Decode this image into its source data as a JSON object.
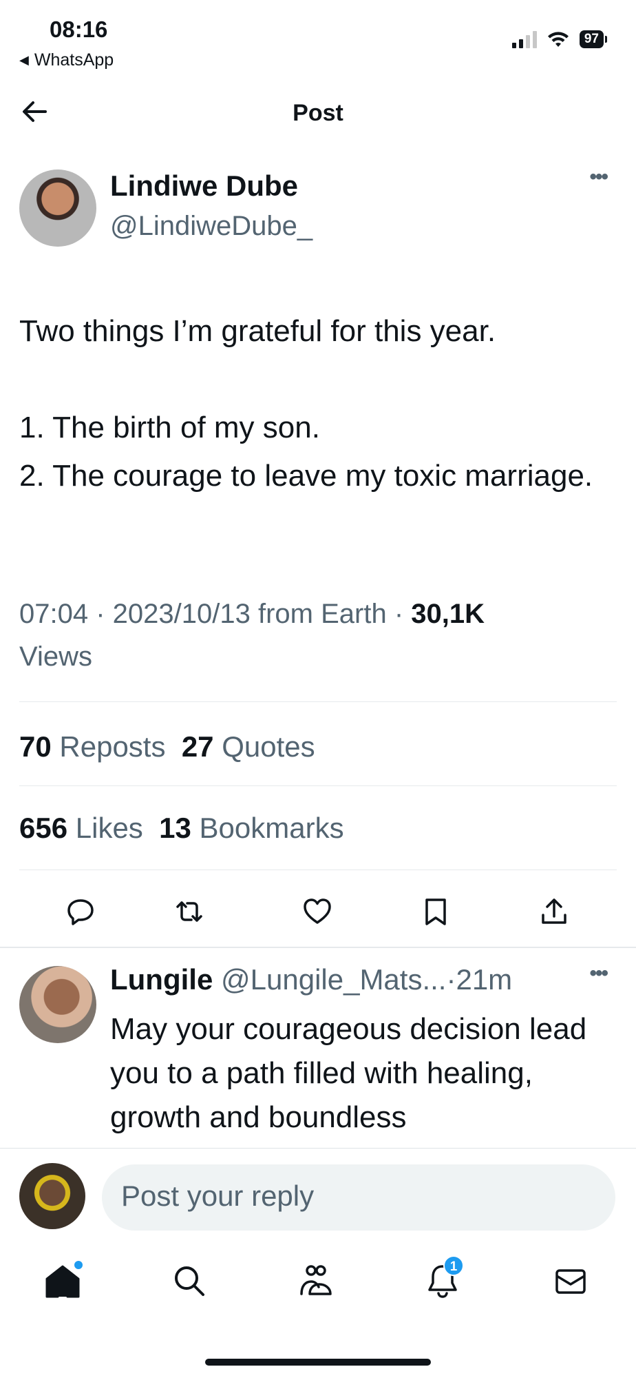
{
  "status_bar": {
    "time": "08:16",
    "back_app": "WhatsApp",
    "battery": "97"
  },
  "header": {
    "title": "Post"
  },
  "post": {
    "author_name": "Lindiwe Dube",
    "author_handle": "@LindiweDube_",
    "text": "Two things I’m grateful for this year.\n\n1. The birth of my son.\n2. The courage to leave my toxic marriage.",
    "time": "07:04",
    "date": "2023/10/13",
    "from_label": "from Earth",
    "views_count": "30,1K",
    "views_label": "Views",
    "reposts_count": "70",
    "reposts_label": "Reposts",
    "quotes_count": "27",
    "quotes_label": "Quotes",
    "likes_count": "656",
    "likes_label": "Likes",
    "bookmarks_count": "13",
    "bookmarks_label": "Bookmarks"
  },
  "reply": {
    "name": "Lungile",
    "handle": "@Lungile_Mats...",
    "age": "21m",
    "text": "May your courageous decision lead you to a path filled with healing, growth and boundless"
  },
  "composer": {
    "placeholder": "Post your reply"
  },
  "nav": {
    "notifications_badge": "1"
  },
  "colors": {
    "text_primary": "#0f1419",
    "text_secondary": "#536471",
    "accent": "#1d9bf0",
    "divider": "#e6e9ec"
  },
  "icons": [
    "back-arrow-icon",
    "more-icon",
    "reply-icon",
    "repost-icon",
    "like-icon",
    "bookmark-icon",
    "share-icon",
    "home-icon",
    "search-icon",
    "communities-icon",
    "notifications-icon",
    "messages-icon"
  ]
}
